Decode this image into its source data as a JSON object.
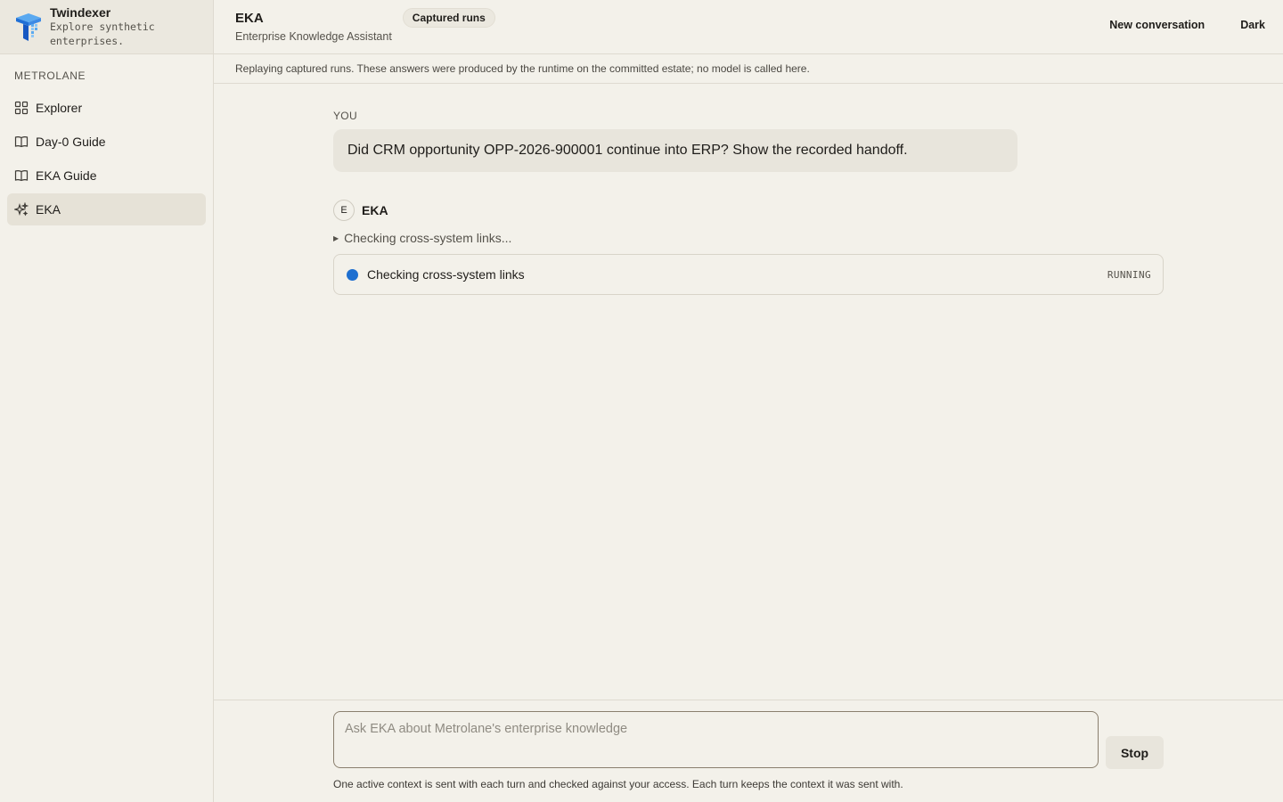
{
  "brand": {
    "name": "Twindexer",
    "tagline": "Explore synthetic enterprises."
  },
  "sidebar": {
    "section_label": "METROLANE",
    "items": [
      {
        "label": "Explorer",
        "icon": "grid-icon"
      },
      {
        "label": "Day-0 Guide",
        "icon": "book-icon"
      },
      {
        "label": "EKA Guide",
        "icon": "book-icon"
      },
      {
        "label": "EKA",
        "icon": "sparkle-icon",
        "active": true
      }
    ]
  },
  "header": {
    "title": "EKA",
    "subtitle": "Enterprise Knowledge Assistant",
    "pill": "Captured runs",
    "new_conversation": "New conversation",
    "theme_toggle": "Dark"
  },
  "banner": "Replaying captured runs. These answers were produced by the runtime on the committed estate; no model is called here.",
  "conversation": {
    "you_label": "YOU",
    "user_message": "Did CRM opportunity OPP-2026-900001 continue into ERP? Show the recorded handoff.",
    "assistant_avatar": "E",
    "assistant_name": "EKA",
    "trace_label": "Checking cross-system links...",
    "status_text": "Checking cross-system links",
    "status_badge": "RUNNING",
    "status_color": "#1e6fd0"
  },
  "composer": {
    "placeholder": "Ask EKA about Metrolane's enterprise knowledge",
    "stop_label": "Stop",
    "note": "One active context is sent with each turn and checked against your access. Each turn keeps the context it was sent with."
  }
}
